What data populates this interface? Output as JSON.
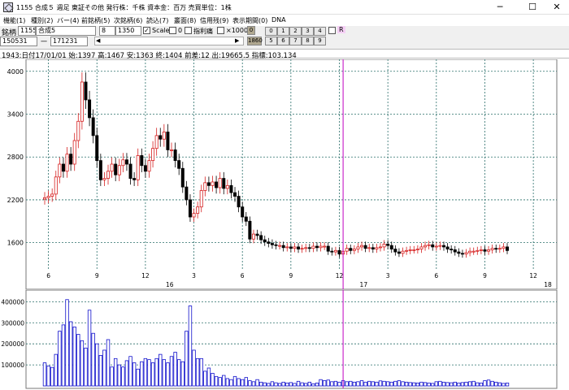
{
  "window": {
    "title": "1155 合成５  週足  東証その他  発行株：千株  資本金：百万  売買単位：1株",
    "minimize_glyph": "─",
    "maximize_glyph": "☐",
    "close_glyph": "✕"
  },
  "menu": [
    "機能(1)",
    "種別(2)",
    "バー(4)",
    "前銘柄(5)",
    "次銘柄(6)",
    "読込(7)",
    "叢面(8)",
    "信用残(9)",
    "表示期間(0)",
    "DNA"
  ],
  "toolbar": {
    "code_label": "銘柄",
    "code_value": "1155",
    "name_value": "合成5",
    "field_a": "8",
    "field_b": "1350",
    "scale_label": "Scale",
    "zero_label": "0",
    "margin_label": "指利痛",
    "x1000_label": "×1000",
    "o_label": "0",
    "digit_buttons_row1": [
      "0",
      "1",
      "2",
      "3",
      "4"
    ],
    "digit_buttons_row2": [
      "5",
      "6",
      "7",
      "8",
      "9"
    ],
    "r_label": "R",
    "from_date": "150531",
    "dash": "一",
    "to_date": "171231",
    "scroll_left": "◀",
    "scroll_right": "▶",
    "year_button": "1860"
  },
  "info": {
    "text": "1943:日付17/01/01 始:1397 高:1467 安:1363 終:1404 前差:12 出:19665.5 指標:103.134"
  },
  "colors": {
    "up_candle": "#d62020",
    "down_candle": "#000000",
    "grid": "#2a6f6a",
    "cursor": "#c000c0",
    "volume": "#1010cc"
  },
  "chart_data": [
    {
      "type": "candlestick",
      "ylim": [
        1300,
        4100
      ],
      "y_ticks": [
        "4000",
        "3400",
        "2800",
        "2200",
        "1600"
      ],
      "y_tick_values": [
        4000,
        3400,
        2800,
        2200,
        1600
      ],
      "x_tick_labels": [
        "6",
        "9",
        "12",
        "3",
        "6",
        "9",
        "12",
        "3",
        "6",
        "9",
        "12"
      ],
      "year_labels": [
        "16",
        "17",
        "18"
      ],
      "cursor_week": 80,
      "close": [
        2230,
        2250,
        2280,
        2520,
        2700,
        2600,
        2840,
        2700,
        3030,
        3300,
        3850,
        3600,
        3350,
        3100,
        2750,
        2480,
        2500,
        2600,
        2700,
        2550,
        2680,
        2760,
        2700,
        2500,
        2480,
        2820,
        2680,
        2600,
        2750,
        2920,
        3100,
        3050,
        3150,
        2900,
        2900,
        2750,
        2640,
        2380,
        2200,
        1960,
        2010,
        2100,
        2330,
        2440,
        2400,
        2450,
        2370,
        2500,
        2360,
        2400,
        2300,
        2250,
        2100,
        1960,
        1900,
        1650,
        1720,
        1700,
        1640,
        1610,
        1590,
        1570,
        1560,
        1560,
        1530,
        1540,
        1520,
        1540,
        1510,
        1520,
        1530,
        1520,
        1550,
        1530,
        1550,
        1550,
        1480,
        1470,
        1490,
        1440,
        1480,
        1520,
        1490,
        1510,
        1540,
        1560,
        1520,
        1530,
        1510,
        1530,
        1540,
        1580,
        1560,
        1510,
        1470,
        1450,
        1480,
        1490,
        1500,
        1500,
        1510,
        1540,
        1560,
        1570,
        1540,
        1550,
        1560,
        1540,
        1510,
        1500,
        1470,
        1450,
        1440,
        1460,
        1480,
        1480,
        1490,
        1500,
        1480,
        1500,
        1520,
        1510,
        1520,
        1540,
        1490
      ],
      "volume": [
        110000,
        95000,
        88000,
        150000,
        260000,
        290000,
        410000,
        305000,
        280000,
        245000,
        215000,
        180000,
        360000,
        250000,
        200000,
        145000,
        170000,
        220000,
        90000,
        130000,
        100000,
        90000,
        120000,
        140000,
        110000,
        80000,
        115000,
        130000,
        125000,
        110000,
        130000,
        150000,
        125000,
        110000,
        140000,
        160000,
        125000,
        115000,
        260000,
        380000,
        170000,
        130000,
        130000,
        70000,
        85000,
        60000,
        45000,
        40000,
        50000,
        35000,
        30000,
        45000,
        35000,
        30000,
        40000,
        25000,
        20000,
        30000,
        18000,
        15000,
        12000,
        20000,
        15000,
        12000,
        18000,
        14000,
        16000,
        12000,
        22000,
        15000,
        12000,
        18000,
        10000,
        14000,
        30000,
        25000,
        28000,
        20000,
        22000,
        18000,
        25000,
        20000,
        22000,
        18000,
        20000,
        25000,
        18000,
        22000,
        20000,
        18000,
        24000,
        22000,
        20000,
        18000,
        22000,
        25000,
        20000,
        18000,
        16000,
        15000,
        14000,
        18000,
        16000,
        14000,
        12000,
        20000,
        22000,
        18000,
        16000,
        15000,
        18000,
        14000,
        16000,
        18000,
        20000,
        22000,
        15000,
        14000,
        25000,
        28000,
        22000,
        18000,
        15000,
        12000,
        14000
      ],
      "volume_ylim": [
        0,
        440000
      ],
      "volume_ticks": [
        "400000",
        "300000",
        "200000",
        "100000"
      ],
      "volume_tick_values": [
        400000,
        300000,
        200000,
        100000
      ]
    }
  ]
}
